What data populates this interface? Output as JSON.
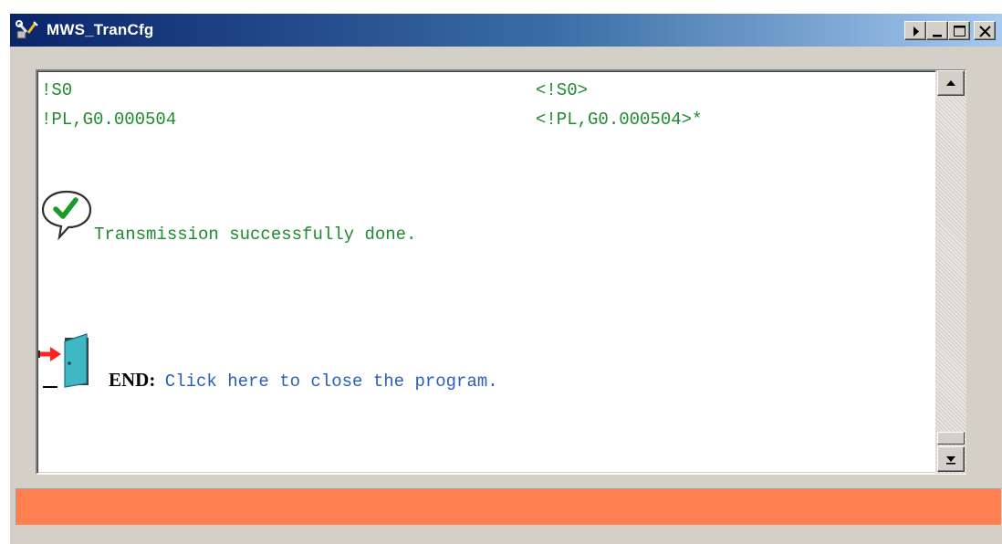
{
  "window": {
    "title": "MWS_TranCfg",
    "title_icon": "tools-wrench-icon",
    "controls": [
      "help-arrow-icon",
      "minimize-icon",
      "maximize-icon",
      "close-icon"
    ]
  },
  "log": {
    "rows": [
      {
        "command": "!S0",
        "response": "<!S0>"
      },
      {
        "command": "!PL,G0.000504",
        "response": "<!PL,G0.000504>*"
      }
    ],
    "success_icon": "checkmark-bubble-icon",
    "success_message": "Transmission successfully done.",
    "end_icon": "exit-door-icon",
    "end_label": "END:",
    "end_link": "Click here to close the program."
  },
  "colors": {
    "log_text": "#1f8a2e",
    "link_text": "#2960b8",
    "status_bar": "#ff7f50",
    "title_bar_start": "#0a246a",
    "title_bar_end": "#a6caf0"
  }
}
